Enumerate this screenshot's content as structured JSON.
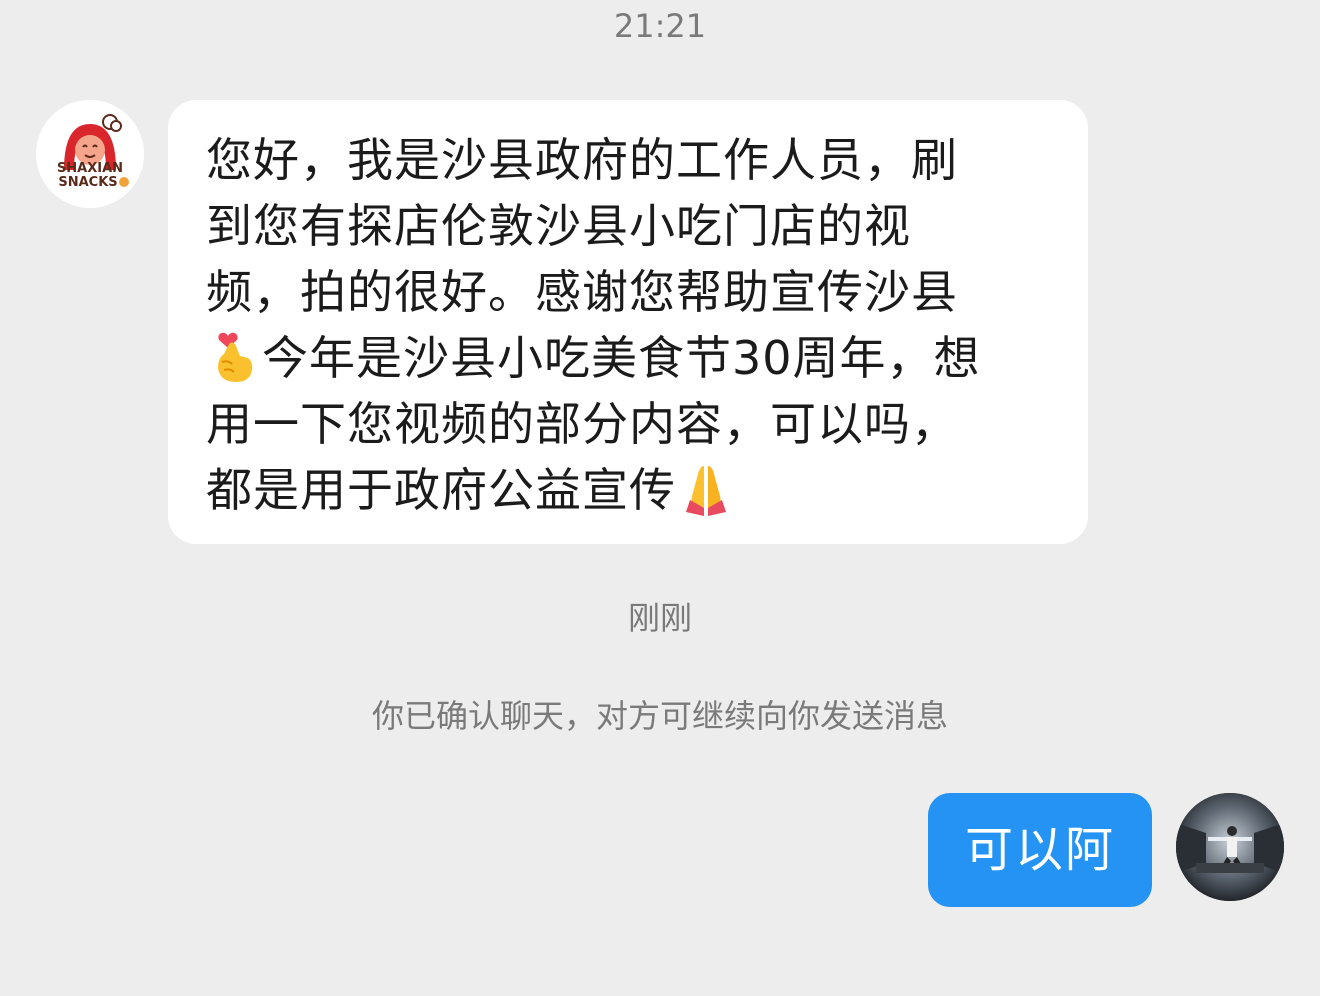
{
  "header": {
    "time": "21:21"
  },
  "contact": {
    "avatar_logo_text_line1": "SHAXIAN",
    "avatar_logo_text_line2": "SNACKS"
  },
  "incoming_message": {
    "lines": [
      "您好，我是沙县政府的工作人员，刷",
      "到您有探店伦敦沙县小吃门店的视",
      "频，拍的很好。感谢您帮助宣传沙县",
      "今年是沙县小吃美食节30周年，想",
      "用一下您视频的部分内容，可以吗，",
      "都是用于政府公益宣传"
    ],
    "emoji_finger_heart": "finger-heart-emoji",
    "emoji_pray": "folded-hands-emoji"
  },
  "meta": {
    "time_label": "刚刚",
    "system_note": "你已确认聊天，对方可继续向你发送消息"
  },
  "outgoing_message": {
    "text": "可以阿"
  },
  "colors": {
    "background": "#ededed",
    "incoming_bubble": "#ffffff",
    "outgoing_bubble": "#2493f4",
    "muted_text": "#7a7a7a"
  }
}
